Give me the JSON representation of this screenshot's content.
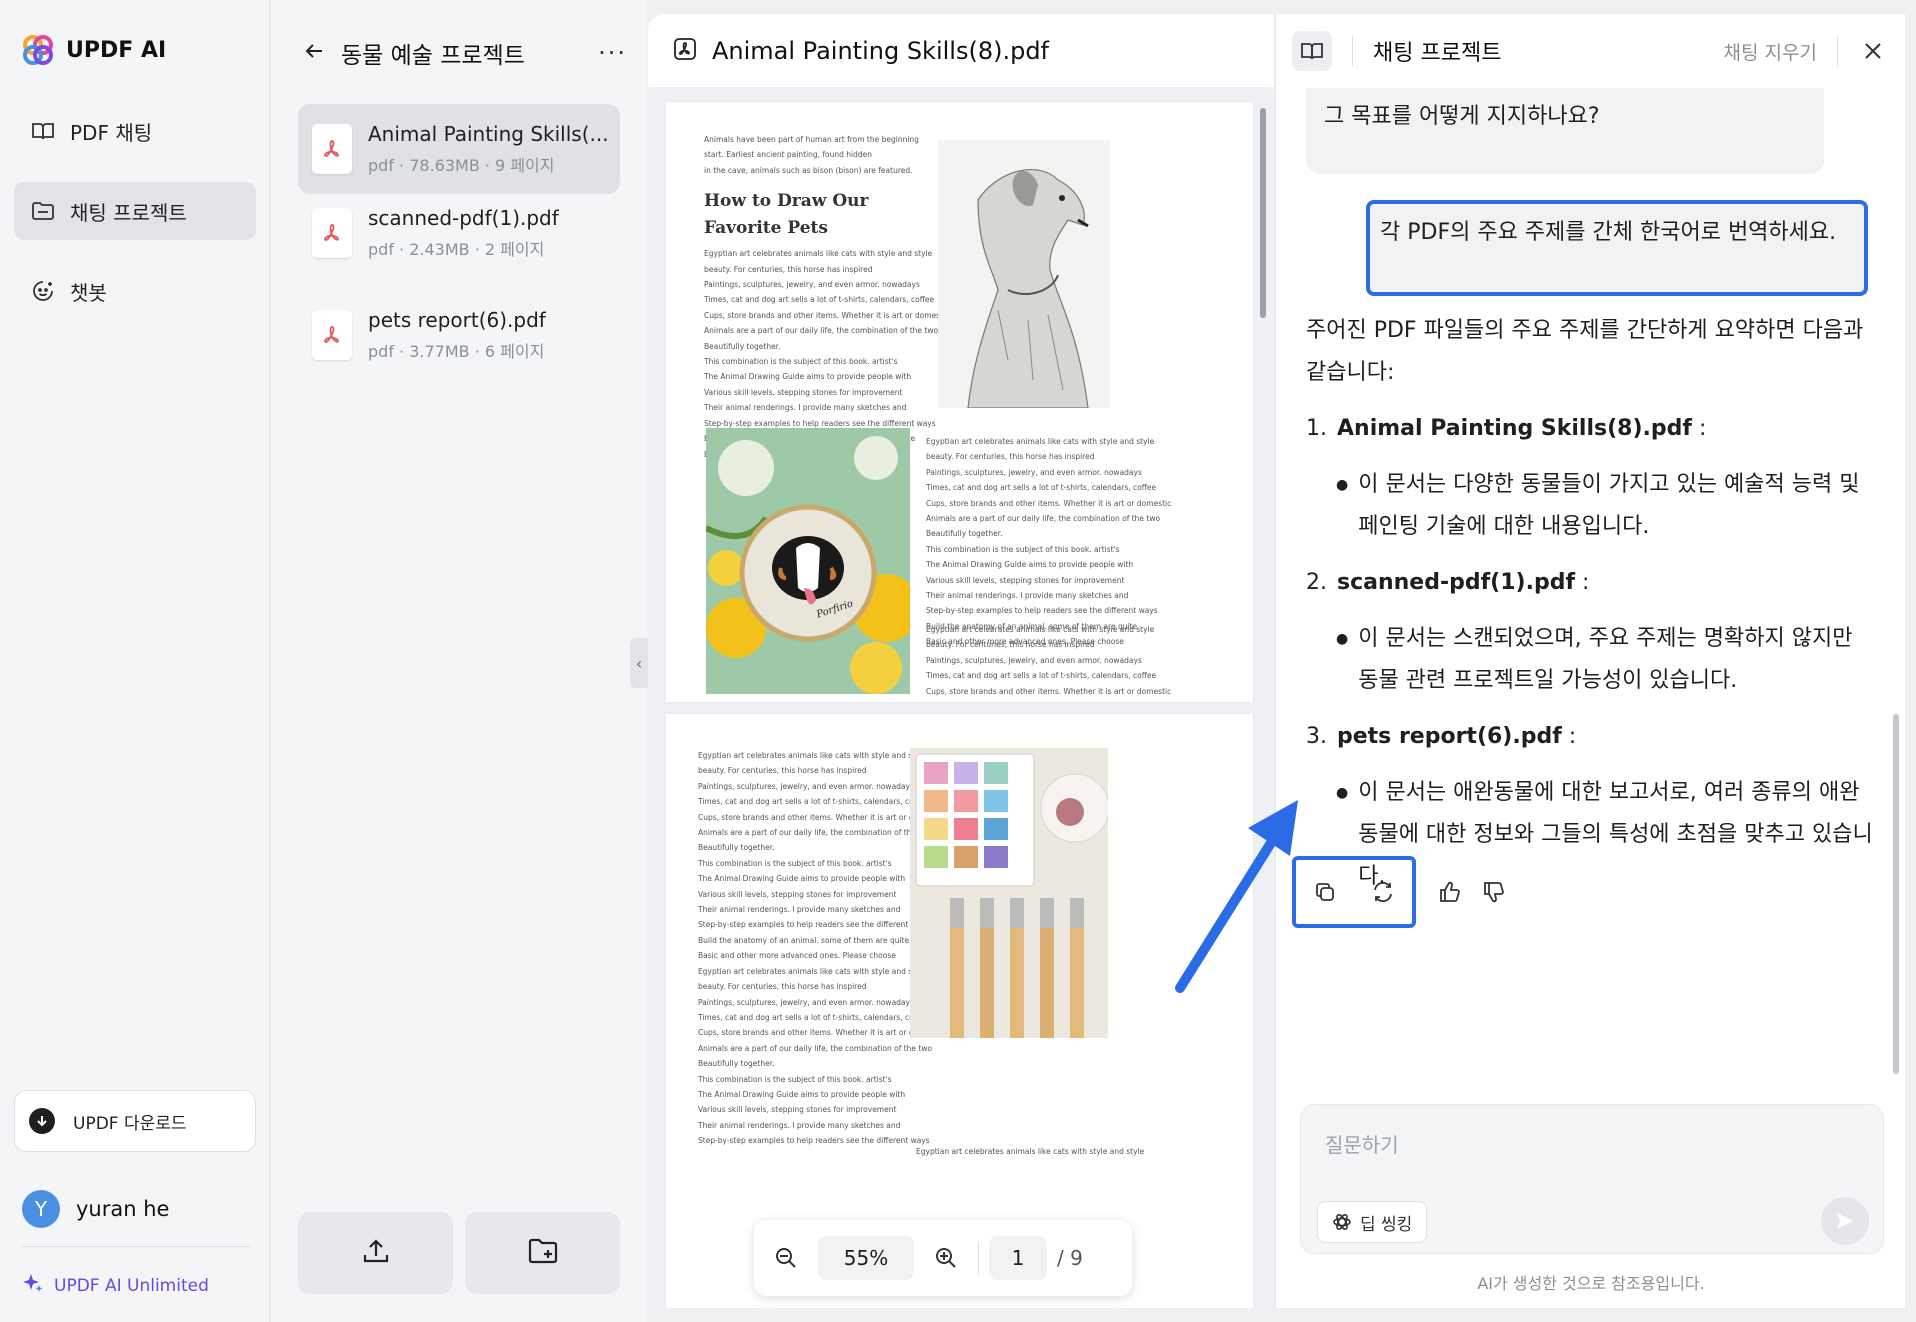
{
  "app": {
    "name": "UPDF AI"
  },
  "sidebar": {
    "items": [
      {
        "label": "PDF 채팅",
        "icon": "book-open-icon"
      },
      {
        "label": "채팅 프로젝트",
        "icon": "folder-chat-icon",
        "active": true
      },
      {
        "label": "챗봇",
        "icon": "bot-icon"
      }
    ],
    "download_label": "UPDF 다운로드",
    "user": {
      "initial": "Y",
      "name": "yuran he"
    },
    "plan_label": "UPDF AI Unlimited"
  },
  "project": {
    "title": "동물 예술 프로젝트",
    "more_label": "···",
    "files": [
      {
        "name": "Animal Painting Skills(...",
        "meta": "pdf · 78.63MB · 9 페이지",
        "active": true
      },
      {
        "name": "scanned-pdf(1).pdf",
        "meta": "pdf · 2.43MB · 2 페이지"
      },
      {
        "name": "pets report(6).pdf",
        "meta": "pdf · 3.77MB · 6 페이지"
      }
    ]
  },
  "viewer": {
    "title": "Animal Painting Skills(8).pdf",
    "zoom": "55%",
    "page_current": "1",
    "page_total": "/ 9",
    "page1": {
      "intro": [
        "Animals have been part of human art from the beginning",
        "start. Earliest ancient painting, found hidden",
        "in the cave, animals such as bison (bison) are featured."
      ],
      "heading": [
        "How to Draw Our",
        "Favorite Pets"
      ],
      "body": [
        "Egyptian art celebrates animals like cats with style and style",
        "beauty. For centuries, this horse has inspired",
        "Paintings, sculptures, jewelry, and even armor. nowadays",
        "Times, cat and dog art sells a lot of t-shirts, calendars, coffee",
        "Cups, store brands and other items. Whether it is art or domestic",
        "Animals are a part of our daily life, the combination of the two",
        "Beautifully together.",
        "This combination is the subject of this book. artist's",
        "The Animal Drawing Guide aims to provide people with",
        "Various skill levels, stepping stones for improvement",
        "Their animal renderings. I provide many sketches and",
        "Step-by-step examples to help readers see the different ways",
        "Build the anatomy of an animal. some of them are quite",
        "Basic and other more advanced ones. Please choose"
      ],
      "right_col": [
        "Egyptian art celebrates animals like cats with style and style",
        "beauty. For centuries, this horse has inspired",
        "Paintings, sculptures, jewelry, and even armor. nowadays",
        "Times, cat and dog art sells a lot of t-shirts, calendars, coffee",
        "Cups, store brands and other items. Whether it is art or domestic",
        "Animals are a part of our daily life, the combination of the two",
        "Beautifully together.",
        "This combination is the subject of this book. artist's",
        "The Animal Drawing Guide aims to provide people with",
        "Various skill levels, stepping stones for improvement",
        "Their animal renderings. I provide many sketches and",
        "Step-by-step examples to help readers see the different ways",
        "Build the anatomy of an animal. some of them are quite",
        "Basic and other more advanced ones. Please choose"
      ],
      "right_col2": [
        "Egyptian art celebrates animals like cats with style and style",
        "beauty. For centuries, this horse has inspired",
        "Paintings, sculptures, jewelry, and even armor. nowadays",
        "Times, cat and dog art sells a lot of t-shirts, calendars, coffee",
        "Cups, store brands and other items. Whether it is art or domestic"
      ],
      "embroidery_text": "Porfirio"
    },
    "page2": {
      "body": [
        "Egyptian art celebrates animals like cats with style and style",
        "beauty. For centuries, this horse has inspired",
        "Paintings, sculptures, jewelry, and even armor. nowadays",
        "Times, cat and dog art sells a lot of t-shirts, calendars, coffee",
        "Cups, store brands and other items. Whether it is art or domestic",
        "Animals are a part of our daily life, the combination of the two",
        "Beautifully together.",
        "This combination is the subject of this book. artist's",
        "The Animal Drawing Guide aims to provide people with",
        "Various skill levels, stepping stones for improvement",
        "Their animal renderings. I provide many sketches and",
        "Step-by-step examples to help readers see the different ways",
        "Build the anatomy of an animal. some of them are quite",
        "Basic and other more advanced ones. Please choose",
        "Egyptian art celebrates animals like cats with style and style",
        "beauty. For centuries, this horse has inspired",
        "Paintings, sculptures, jewelry, and even armor. nowadays",
        "Times, cat and dog art sells a lot of t-shirts, calendars, coffee",
        "Cups, store brands and other items. Whether it is art or domestic",
        "Animals are a part of our daily life, the combination of the two",
        "Beautifully together.",
        "This combination is the subject of this book. artist's",
        "The Animal Drawing Guide aims to provide people with",
        "Various skill levels, stepping stones for improvement",
        "Their animal renderings. I provide many sketches and",
        "Step-by-step examples to help readers see the different ways"
      ],
      "bottom_right": "Egyptian art celebrates animals like cats with style and style"
    }
  },
  "chat": {
    "title": "채팅 프로젝트",
    "clear_label": "채팅 지우기",
    "prev_question": "이 프로젝트의 궁극적인 목표는 무엇이며, 각 문서가 그 목표를 어떻게 지지하나요?",
    "user_message": "각 PDF의 주요 주제를 간체 한국어로 번역하세요.",
    "answer": {
      "intro": "주어진 PDF 파일들의 주요 주제를 간단하게 요약하면 다음과 같습니다:",
      "items": [
        {
          "num": "1.",
          "title": "Animal Painting Skills(8).pdf",
          "suffix": " :",
          "bullet": "이 문서는 다양한 동물들이 가지고 있는 예술적 능력 및 페인팅 기술에 대한 내용입니다."
        },
        {
          "num": "2.",
          "title": "scanned-pdf(1).pdf",
          "suffix": " :",
          "bullet": "이 문서는 스캔되었으며, 주요 주제는 명확하지 않지만 동물 관련 프로젝트일 가능성이 있습니다."
        },
        {
          "num": "3.",
          "title": "pets report(6).pdf",
          "suffix": " :",
          "bullet": "이 문서는 애완동물에 대한 보고서로, 여러 종류의 애완동물에 대한 정보와 그들의 특성에 초점을 맞추고 있습니다."
        }
      ]
    },
    "input_placeholder": "질문하기",
    "deep_thinking_label": "딥 씽킹",
    "disclaimer": "AI가 생성한 것으로 참조용입니다."
  },
  "colors": {
    "accent_blue": "#2b6ce6",
    "brand_purple": "#6a48e0",
    "pdf_red": "#e05a5a"
  }
}
